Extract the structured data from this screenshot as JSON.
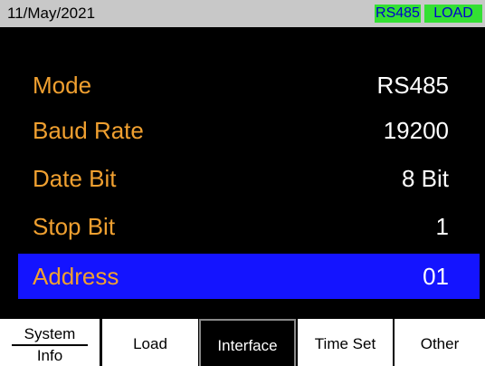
{
  "status": {
    "date": "11/May/2021",
    "interface_badge": "RS485",
    "mode_badge": "LOAD"
  },
  "settings": [
    {
      "label": "Mode",
      "value": "RS485"
    },
    {
      "label": "Baud Rate",
      "value": "19200"
    },
    {
      "label": "Date Bit",
      "value": "8 Bit"
    },
    {
      "label": "Stop Bit",
      "value": "1"
    },
    {
      "label": "Address",
      "value": "01"
    }
  ],
  "softkeys": {
    "system_top": "System",
    "system_bottom": "Info",
    "load": "Load",
    "interface": "Interface",
    "time_set": "Time Set",
    "other": "Other"
  },
  "colors": {
    "label": "#f0a030",
    "value": "#ffffff",
    "selection": "#1414ff",
    "badge_bg": "#33e033",
    "badge_text": "#0000cc"
  }
}
